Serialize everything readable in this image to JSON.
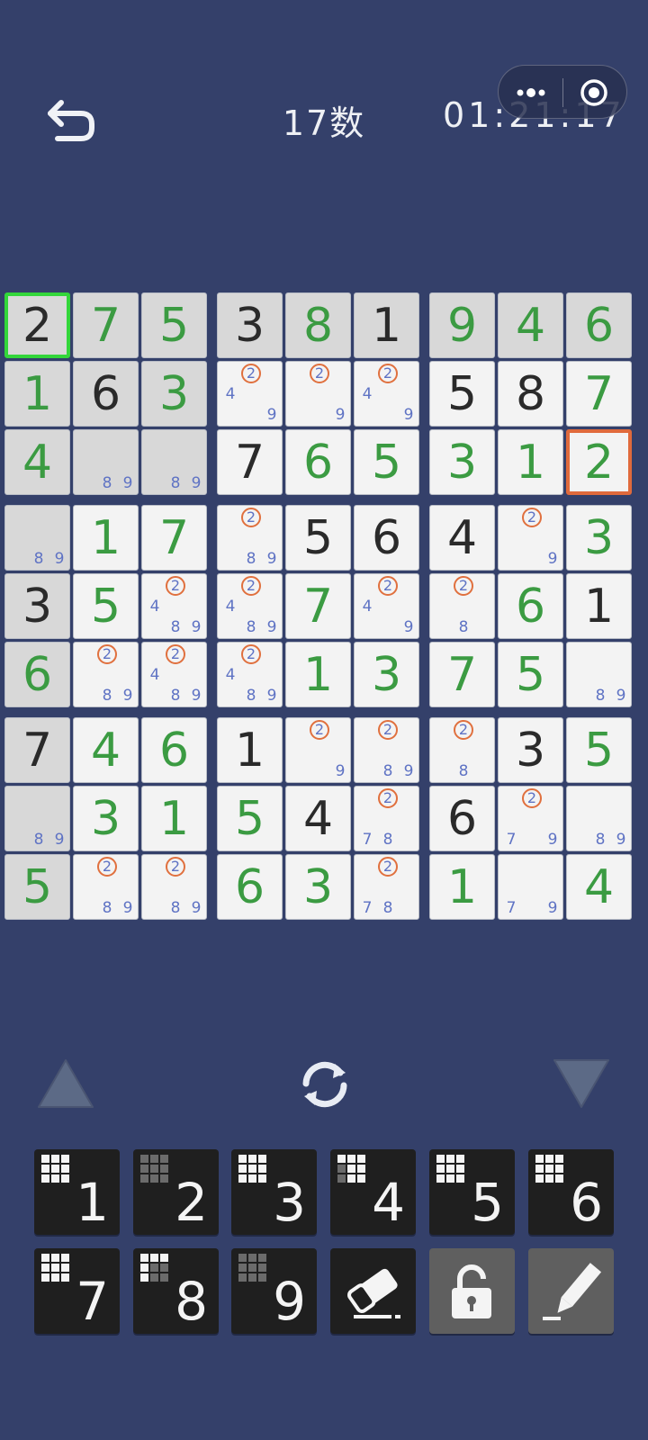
{
  "header": {
    "title": "17数",
    "timer": "01:21:17",
    "back_icon": "back-arrow-icon",
    "more_icon": "more-dots-icon",
    "close_icon": "target-circle-icon"
  },
  "colors": {
    "background": "#34406a",
    "given_digit": "#2a2a2a",
    "entered_digit": "#3b9b42",
    "note_digit": "#5f73c4",
    "highlight_note_ring": "#e0703e",
    "selected_border": "#33d63a",
    "conflict_border": "#e06a3c"
  },
  "board": {
    "cells": [
      [
        {
          "v": "2",
          "c": "black",
          "given": true,
          "selected": true
        },
        {
          "v": "7",
          "c": "green",
          "given": true
        },
        {
          "v": "5",
          "c": "green",
          "given": true
        },
        {
          "v": "3",
          "c": "black",
          "given": true
        },
        {
          "v": "8",
          "c": "green",
          "given": true
        },
        {
          "v": "1",
          "c": "black",
          "given": true
        },
        {
          "v": "9",
          "c": "green",
          "given": true
        },
        {
          "v": "4",
          "c": "green",
          "given": true
        },
        {
          "v": "6",
          "c": "green",
          "given": true
        }
      ],
      [
        {
          "v": "1",
          "c": "green",
          "given": true
        },
        {
          "v": "6",
          "c": "black",
          "given": true
        },
        {
          "v": "3",
          "c": "green",
          "given": true
        },
        {
          "notes": [
            "2",
            "4",
            "9"
          ]
        },
        {
          "notes": [
            "2",
            "9"
          ]
        },
        {
          "notes": [
            "2",
            "4",
            "9"
          ]
        },
        {
          "v": "5",
          "c": "black"
        },
        {
          "v": "8",
          "c": "black"
        },
        {
          "v": "7",
          "c": "green"
        }
      ],
      [
        {
          "v": "4",
          "c": "green",
          "given": true
        },
        {
          "notes": [
            "8",
            "9"
          ],
          "given": true
        },
        {
          "notes": [
            "8",
            "9"
          ],
          "given": true
        },
        {
          "v": "7",
          "c": "black"
        },
        {
          "v": "6",
          "c": "green"
        },
        {
          "v": "5",
          "c": "green"
        },
        {
          "v": "3",
          "c": "green"
        },
        {
          "v": "1",
          "c": "green"
        },
        {
          "v": "2",
          "c": "green",
          "conflict": true
        }
      ],
      [
        {
          "notes": [
            "8",
            "9"
          ],
          "given": true
        },
        {
          "v": "1",
          "c": "green"
        },
        {
          "v": "7",
          "c": "green"
        },
        {
          "notes": [
            "2",
            "8",
            "9"
          ]
        },
        {
          "v": "5",
          "c": "black"
        },
        {
          "v": "6",
          "c": "black"
        },
        {
          "v": "4",
          "c": "black"
        },
        {
          "notes": [
            "2",
            "9"
          ]
        },
        {
          "v": "3",
          "c": "green"
        }
      ],
      [
        {
          "v": "3",
          "c": "black",
          "given": true
        },
        {
          "v": "5",
          "c": "green"
        },
        {
          "notes": [
            "2",
            "4",
            "8",
            "9"
          ]
        },
        {
          "notes": [
            "2",
            "4",
            "8",
            "9"
          ]
        },
        {
          "v": "7",
          "c": "green"
        },
        {
          "notes": [
            "2",
            "4",
            "9"
          ]
        },
        {
          "notes": [
            "2",
            "8"
          ]
        },
        {
          "v": "6",
          "c": "green"
        },
        {
          "v": "1",
          "c": "black"
        }
      ],
      [
        {
          "v": "6",
          "c": "green",
          "given": true
        },
        {
          "notes": [
            "2",
            "8",
            "9"
          ]
        },
        {
          "notes": [
            "2",
            "4",
            "8",
            "9"
          ]
        },
        {
          "notes": [
            "2",
            "4",
            "8",
            "9"
          ]
        },
        {
          "v": "1",
          "c": "green"
        },
        {
          "v": "3",
          "c": "green"
        },
        {
          "v": "7",
          "c": "green"
        },
        {
          "v": "5",
          "c": "green"
        },
        {
          "notes": [
            "8",
            "9"
          ]
        }
      ],
      [
        {
          "v": "7",
          "c": "black",
          "given": true
        },
        {
          "v": "4",
          "c": "green"
        },
        {
          "v": "6",
          "c": "green"
        },
        {
          "v": "1",
          "c": "black"
        },
        {
          "notes": [
            "2",
            "9"
          ]
        },
        {
          "notes": [
            "2",
            "8",
            "9"
          ]
        },
        {
          "notes": [
            "2",
            "8"
          ]
        },
        {
          "v": "3",
          "c": "black"
        },
        {
          "v": "5",
          "c": "green"
        }
      ],
      [
        {
          "notes": [
            "8",
            "9"
          ],
          "given": true
        },
        {
          "v": "3",
          "c": "green"
        },
        {
          "v": "1",
          "c": "green"
        },
        {
          "v": "5",
          "c": "green"
        },
        {
          "v": "4",
          "c": "black"
        },
        {
          "notes": [
            "2",
            "7",
            "8"
          ]
        },
        {
          "v": "6",
          "c": "black"
        },
        {
          "notes": [
            "2",
            "7",
            "9"
          ]
        },
        {
          "notes": [
            "8",
            "9"
          ]
        }
      ],
      [
        {
          "v": "5",
          "c": "green",
          "given": true
        },
        {
          "notes": [
            "2",
            "8",
            "9"
          ]
        },
        {
          "notes": [
            "2",
            "8",
            "9"
          ]
        },
        {
          "v": "6",
          "c": "green"
        },
        {
          "v": "3",
          "c": "green"
        },
        {
          "notes": [
            "2",
            "7",
            "8"
          ]
        },
        {
          "v": "1",
          "c": "green"
        },
        {
          "notes": [
            "7",
            "9"
          ]
        },
        {
          "v": "4",
          "c": "green"
        }
      ]
    ],
    "highlighted_note": "2"
  },
  "controls": {
    "prev_icon": "triangle-up-icon",
    "refresh_icon": "refresh-icon",
    "next_icon": "triangle-down-icon"
  },
  "keypad": {
    "digits": [
      {
        "label": "1",
        "remaining_mask": [
          1,
          1,
          1,
          1,
          1,
          1,
          1,
          1,
          1
        ]
      },
      {
        "label": "2",
        "remaining_mask": [
          0,
          0,
          0,
          0,
          0,
          0,
          0,
          0,
          0
        ]
      },
      {
        "label": "3",
        "remaining_mask": [
          1,
          1,
          1,
          1,
          1,
          1,
          1,
          1,
          1
        ]
      },
      {
        "label": "4",
        "remaining_mask": [
          1,
          1,
          1,
          0,
          1,
          1,
          0,
          1,
          1
        ]
      },
      {
        "label": "5",
        "remaining_mask": [
          1,
          1,
          1,
          1,
          1,
          1,
          1,
          1,
          1
        ]
      },
      {
        "label": "6",
        "remaining_mask": [
          1,
          1,
          1,
          1,
          1,
          1,
          1,
          1,
          1
        ]
      },
      {
        "label": "7",
        "remaining_mask": [
          1,
          1,
          1,
          1,
          1,
          1,
          1,
          1,
          1
        ]
      },
      {
        "label": "8",
        "remaining_mask": [
          1,
          1,
          1,
          1,
          0,
          0,
          1,
          0,
          0
        ]
      },
      {
        "label": "9",
        "remaining_mask": [
          0,
          0,
          0,
          0,
          0,
          0,
          0,
          0,
          0
        ]
      }
    ],
    "eraser_icon": "eraser-icon",
    "lock_icon": "lock-icon",
    "pencil_icon": "pencil-icon"
  }
}
